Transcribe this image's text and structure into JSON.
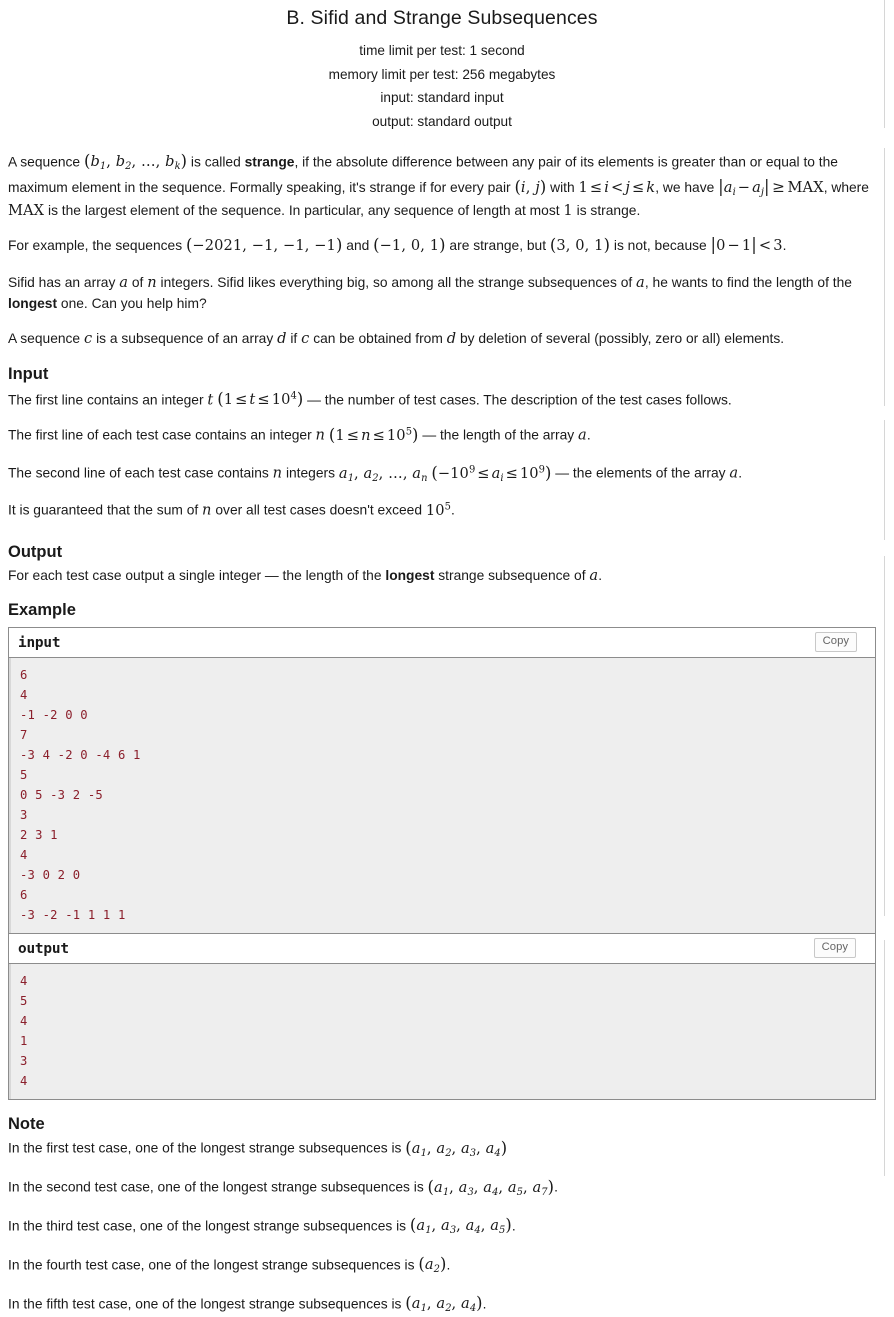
{
  "header": {
    "title": "B. Sifid and Strange Subsequences",
    "time_limit": "time limit per test: 1 second",
    "memory_limit": "memory limit per test: 256 megabytes",
    "input_spec": "input: standard input",
    "output_spec": "output: standard output"
  },
  "statement": {
    "p1_a": "A sequence ",
    "p1_b": " is called ",
    "p1_strange": "strange",
    "p1_c": ", if the absolute difference between any pair of its elements is greater than or equal to the maximum element in the sequence. Formally speaking, it's strange if for every pair ",
    "p1_d": " with ",
    "p1_e": ", we have ",
    "p1_f": ", where ",
    "p1_g": " is the largest element of the sequence. In particular, any sequence of length at most ",
    "p1_h": " is strange.",
    "p2_a": "For example, the sequences ",
    "p2_b": " and ",
    "p2_c": " are strange, but ",
    "p2_d": " is not, because ",
    "p2_e": ".",
    "p3_a": "Sifid has an array ",
    "p3_b": " of ",
    "p3_c": " integers. Sifid likes everything big, so among all the strange subsequences of ",
    "p3_d": ", he wants to find the length of the ",
    "p3_longest": "longest",
    "p3_e": " one. Can you help him?",
    "p4_a": "A sequence ",
    "p4_b": " is a subsequence of an array ",
    "p4_c": " if ",
    "p4_d": " can be obtained from ",
    "p4_e": " by deletion of several (possibly, zero or all) elements."
  },
  "input_section": {
    "title": "Input",
    "l1_a": "The first line contains an integer ",
    "l1_b": " — the number of test cases. The description of the test cases follows.",
    "l2_a": "The first line of each test case contains an integer ",
    "l2_b": " — the length of the array ",
    "l2_c": ".",
    "l3_a": "The second line of each test case contains ",
    "l3_b": " integers ",
    "l3_c": " — the elements of the array ",
    "l3_d": ".",
    "l4_a": "It is guaranteed that the sum of ",
    "l4_b": " over all test cases doesn't exceed ",
    "l4_c": "."
  },
  "output_section": {
    "title": "Output",
    "l1_a": "For each test case output a single integer — the length of the ",
    "l1_longest": "longest",
    "l1_b": " strange subsequence of ",
    "l1_c": "."
  },
  "example_section": {
    "title": "Example",
    "input_label": "input",
    "output_label": "output",
    "copy_label": "Copy",
    "input_lines": [
      "6",
      "4",
      "-1 -2 0 0",
      "7",
      "-3 4 -2 0 -4 6 1",
      "5",
      "0 5 -3 2 -5",
      "3",
      "2 3 1",
      "4",
      "-3 0 2 0",
      "6",
      "-3 -2 -1 1 1 1"
    ],
    "output_lines": [
      "4",
      "5",
      "4",
      "1",
      "3",
      "4"
    ]
  },
  "note_section": {
    "title": "Note",
    "n1_a": "In the first test case, one of the longest strange subsequences is ",
    "n1_b": "",
    "n2_a": "In the second test case, one of the longest strange subsequences is ",
    "n2_b": ".",
    "n3_a": "In the third test case, one of the longest strange subsequences is ",
    "n3_b": ".",
    "n4_a": "In the fourth test case, one of the longest strange subsequences is ",
    "n4_b": ".",
    "n5_a": "In the fifth test case, one of the longest strange subsequences is ",
    "n5_b": "."
  }
}
